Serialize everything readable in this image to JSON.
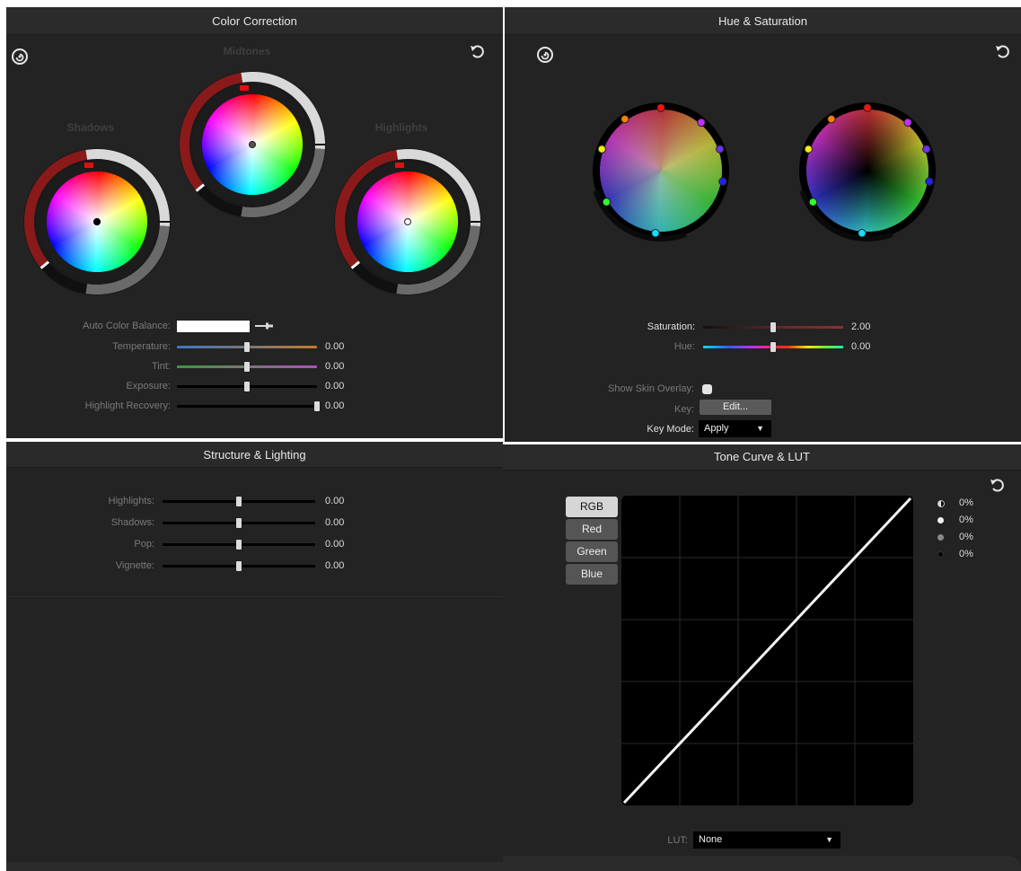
{
  "color_correction": {
    "title": "Color Correction",
    "wheels": {
      "shadows": "Shadows",
      "midtones": "Midtones",
      "highlights": "Highlights"
    },
    "auto_color_balance_label": "Auto Color Balance:",
    "sliders": [
      {
        "label": "Temperature:",
        "value": "0.00",
        "position": 0.5
      },
      {
        "label": "Tint:",
        "value": "0.00",
        "position": 0.5
      },
      {
        "label": "Exposure:",
        "value": "0.00",
        "position": 0.5
      },
      {
        "label": "Highlight Recovery:",
        "value": "0.00",
        "position": 1.0
      }
    ],
    "icons": {
      "left": "target-icon",
      "right": "reset-icon"
    }
  },
  "hue_saturation": {
    "title": "Hue & Saturation",
    "saturation": {
      "label": "Saturation:",
      "value": "2.00",
      "position": 0.5
    },
    "hue": {
      "label": "Hue:",
      "value": "0.00",
      "position": 0.5
    },
    "show_skin_overlay_label": "Show Skin Overlay:",
    "key_label": "Key:",
    "key_button": "Edit...",
    "key_mode_label": "Key Mode:",
    "key_mode_value": "Apply",
    "icons": {
      "left": "target-icon",
      "right": "reset-icon"
    }
  },
  "structure_lighting": {
    "title": "Structure & Lighting",
    "sliders": [
      {
        "label": "Highlights:",
        "value": "0.00",
        "position": 0.5
      },
      {
        "label": "Shadows:",
        "value": "0.00",
        "position": 0.5
      },
      {
        "label": "Pop:",
        "value": "0.00",
        "position": 0.5
      },
      {
        "label": "Vignette:",
        "value": "0.00",
        "position": 0.5
      }
    ]
  },
  "tone_curve": {
    "title": "Tone Curve & LUT",
    "channels": [
      "RGB",
      "Red",
      "Green",
      "Blue"
    ],
    "active_channel": "RGB",
    "legend": [
      {
        "icon": "half-circle-icon",
        "value": "0%"
      },
      {
        "icon": "white-dot-icon",
        "value": "0%"
      },
      {
        "icon": "gray-dot-icon",
        "value": "0%"
      },
      {
        "icon": "black-dot-icon",
        "value": "0%"
      }
    ],
    "lut_label": "LUT:",
    "lut_value": "None",
    "icons": {
      "right": "reset-icon"
    }
  },
  "colors": {
    "panel_bg": "#232323",
    "header_bg": "#2b2b2b",
    "accent_red": "#cc1a1a"
  }
}
